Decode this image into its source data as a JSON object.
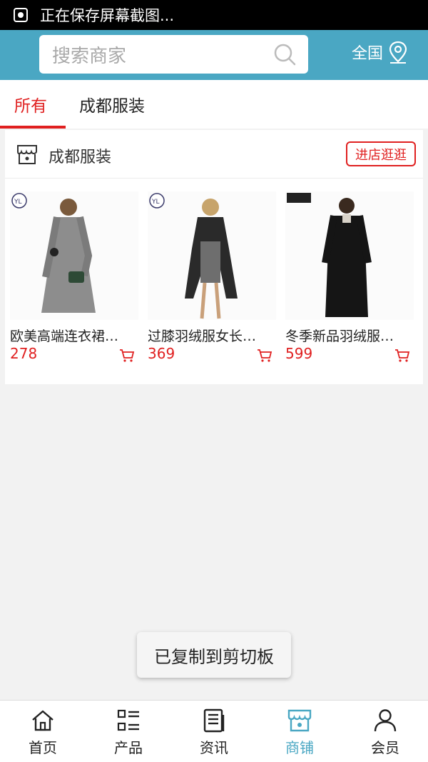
{
  "status_bar": {
    "text": "正在保存屏幕截图..."
  },
  "header": {
    "search": {
      "placeholder": "搜索商家"
    },
    "region_label": "全国",
    "accent": "#4aa7c3"
  },
  "tabs": [
    {
      "label": "所有",
      "active": true
    },
    {
      "label": "成都服装",
      "active": false
    }
  ],
  "shop": {
    "name": "成都服装",
    "visit_label": "进店逛逛",
    "products": [
      {
        "title": "欧美高端连衣裙…",
        "price": "278"
      },
      {
        "title": "过膝羽绒服女长…",
        "price": "369"
      },
      {
        "title": "冬季新品羽绒服…",
        "price": "599"
      }
    ]
  },
  "toast": {
    "text": "已复制到剪切板"
  },
  "bottom_nav": [
    {
      "label": "首页",
      "icon": "home-icon",
      "active": false
    },
    {
      "label": "产品",
      "icon": "grid-list-icon",
      "active": false
    },
    {
      "label": "资讯",
      "icon": "news-icon",
      "active": false
    },
    {
      "label": "商铺",
      "icon": "store-icon",
      "active": true
    },
    {
      "label": "会员",
      "icon": "user-icon",
      "active": false
    }
  ],
  "colors": {
    "accent": "#4aa7c3",
    "price_red": "#e02020",
    "status_bg": "#000000"
  }
}
